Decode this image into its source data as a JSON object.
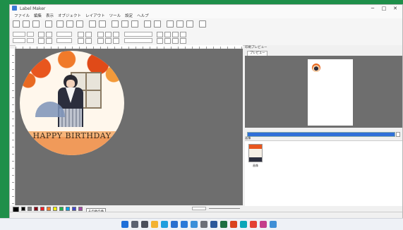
{
  "window": {
    "title": "Label Maker"
  },
  "window_controls": {
    "minimize": "─",
    "maximize": "□",
    "close": "✕"
  },
  "menu": [
    "ファイル",
    "編集",
    "表示",
    "オブジェクト",
    "レイアウト",
    "ツール",
    "設定",
    "ヘルプ"
  ],
  "canvas": {
    "text_overlay": "HAPPY BIRTHDAY"
  },
  "palette": {
    "colors": [
      "#000000",
      "#7f7f7f",
      "#880015",
      "#ed1c24",
      "#ff7f27",
      "#fff200",
      "#22b14c",
      "#00a2e8",
      "#3f48cc",
      "#a349a4",
      "#ffffff",
      "#c3c3c3",
      "#b97a57",
      "#ffaec9",
      "#ffc90e",
      "#efe4b0",
      "#b5e61d",
      "#99d9ea",
      "#7092be",
      "#c8bfe7"
    ],
    "button_label": "その他の色"
  },
  "right_panel": {
    "preview_header": "印刷プレビュー",
    "tab_label": "プレビュー",
    "list_caption": "画像",
    "file_item_label": "画像"
  },
  "taskbar": {
    "apps": [
      "start-icon",
      "search-icon",
      "task-view-icon",
      "explorer-icon",
      "edge-icon",
      "mail-icon",
      "store-icon",
      "photos-icon",
      "settings-icon",
      "word-icon",
      "excel-icon",
      "label-app-icon",
      "paint-icon",
      "chrome-icon",
      "media-icon",
      "calendar-icon"
    ],
    "colors": [
      "#1e6fd9",
      "#5a6270",
      "#4a4f5a",
      "#f2b233",
      "#1f9ede",
      "#2a6fce",
      "#2b79d8",
      "#3a8fd9",
      "#6b6f78",
      "#2b579a",
      "#1d6f42",
      "#d9431e",
      "#0aa6b8",
      "#e34133",
      "#c43d8a",
      "#3f8fd6"
    ]
  }
}
